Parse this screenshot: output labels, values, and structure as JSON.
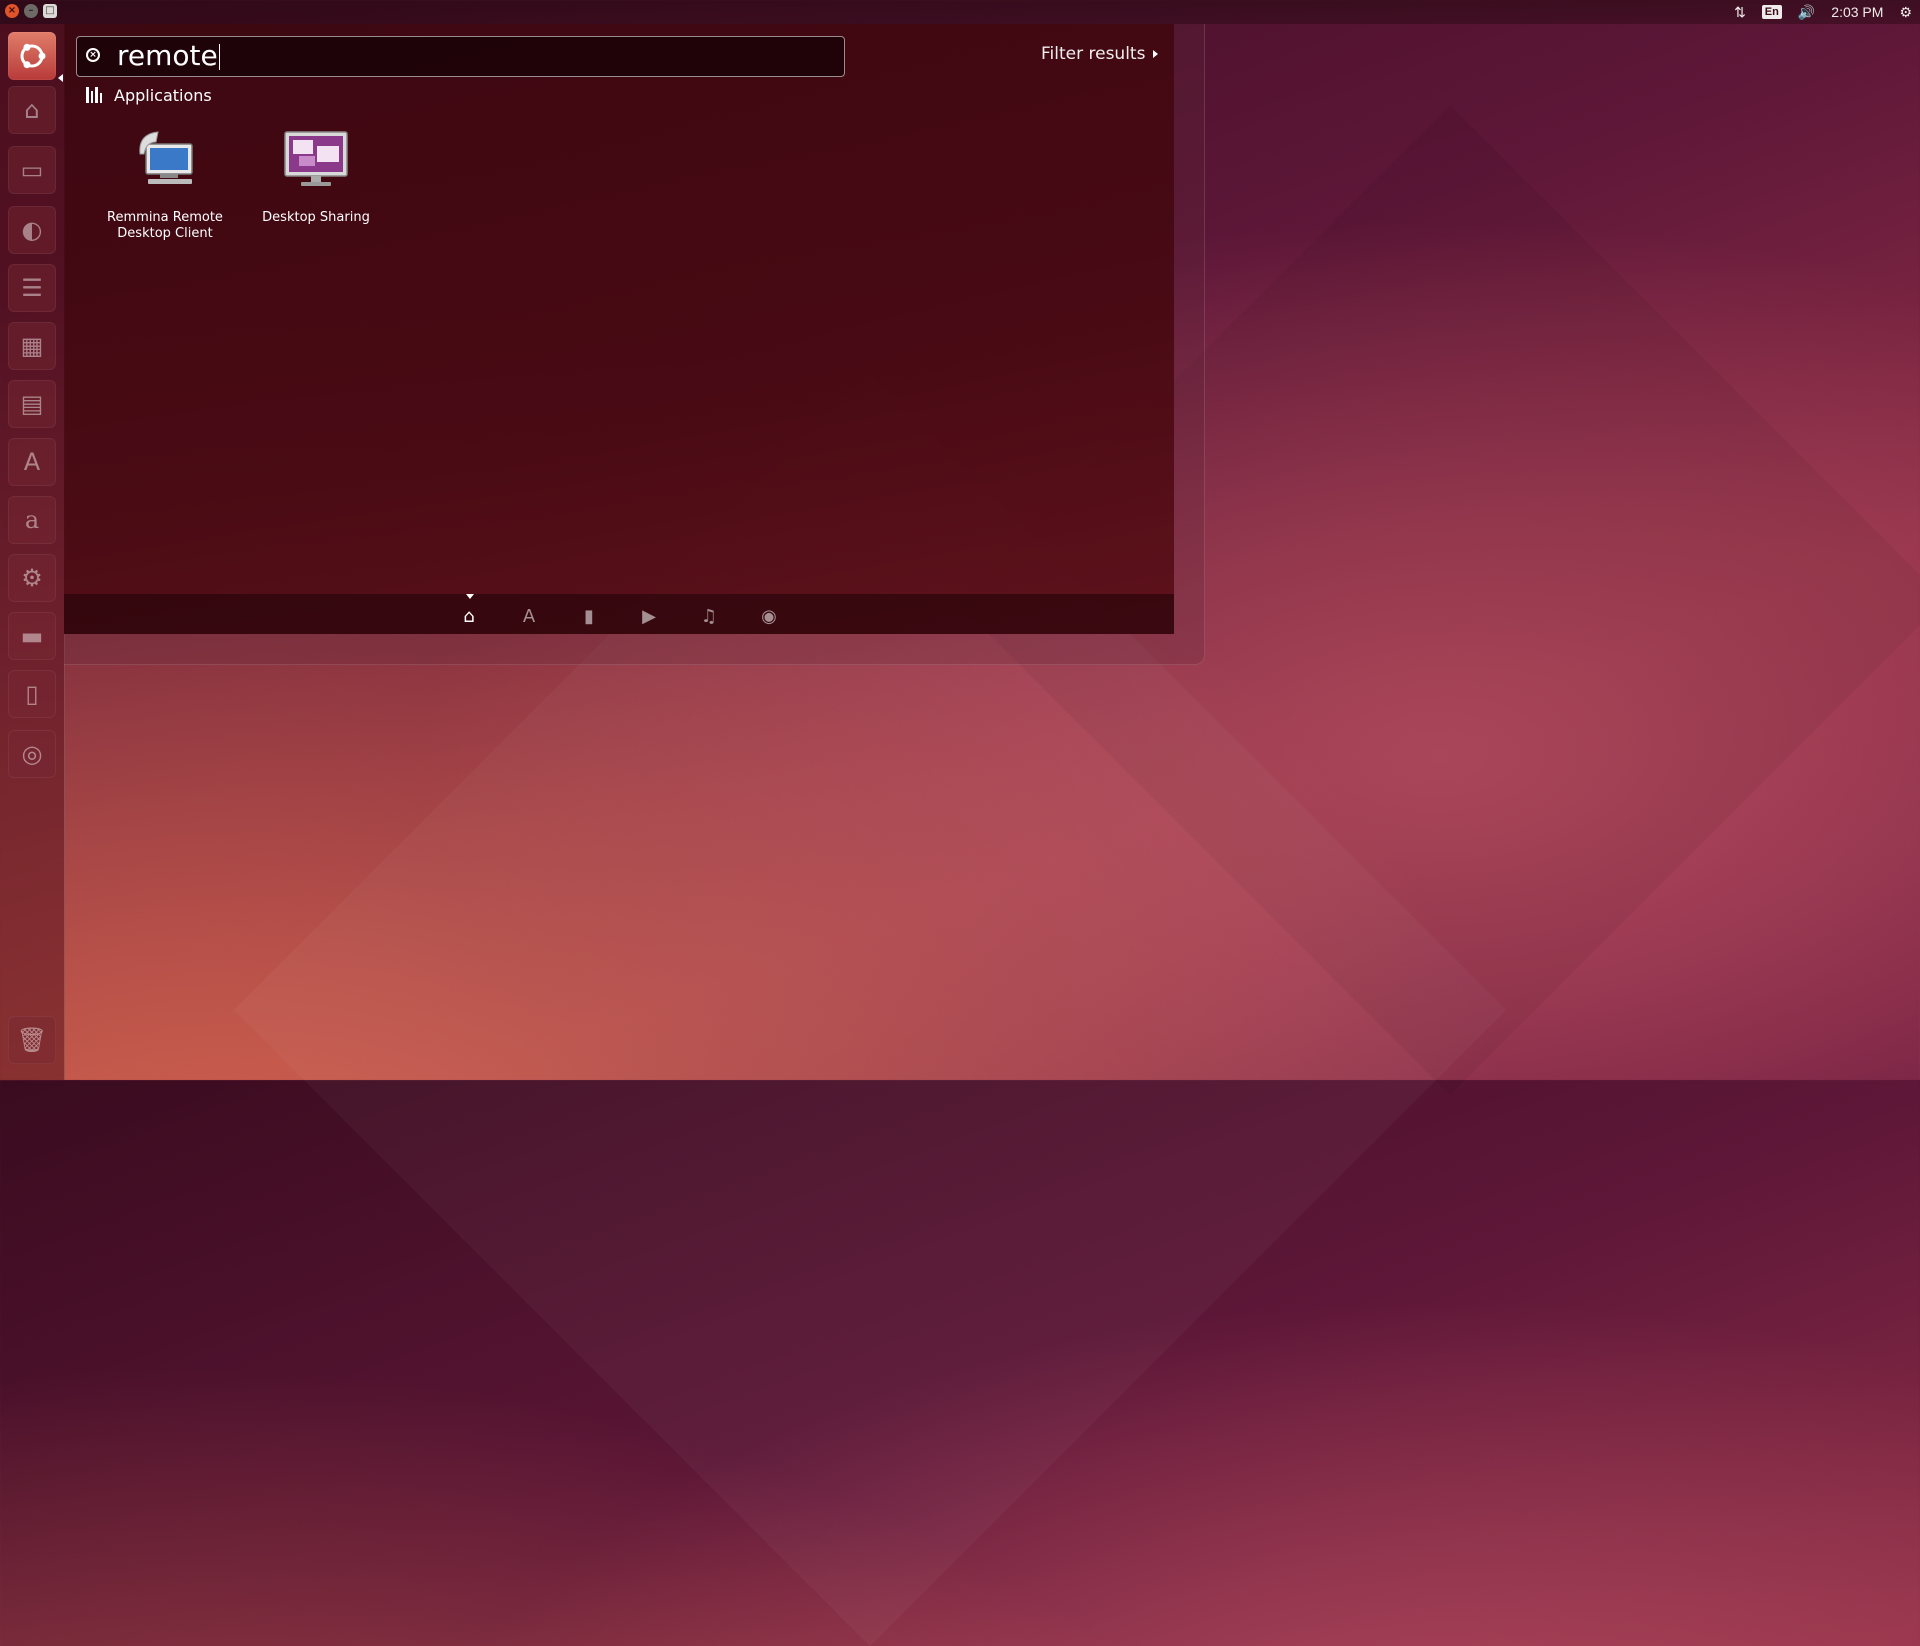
{
  "top_panel": {
    "indicators": {
      "network": "⇅",
      "keyboard": "En",
      "volume": "🔊",
      "clock": "2:03 PM",
      "session": "⚙"
    },
    "window_controls": {
      "close": "×",
      "minimize": "–",
      "maximize": "□"
    }
  },
  "launcher": {
    "items": [
      {
        "name": "dash-home",
        "icon": "ubuntu-logo-icon"
      },
      {
        "name": "files",
        "icon": "home-folder-icon"
      },
      {
        "name": "file-manager",
        "icon": "drawer-icon"
      },
      {
        "name": "firefox",
        "icon": "browser-icon"
      },
      {
        "name": "writer",
        "icon": "document-icon"
      },
      {
        "name": "calc",
        "icon": "spreadsheet-icon"
      },
      {
        "name": "impress",
        "icon": "presentation-icon"
      },
      {
        "name": "software-center",
        "icon": "software-center-icon"
      },
      {
        "name": "amazon",
        "icon": "amazon-icon"
      },
      {
        "name": "system-settings",
        "icon": "settings-icon"
      },
      {
        "name": "disk",
        "icon": "drive-icon"
      },
      {
        "name": "usb",
        "icon": "usb-icon"
      },
      {
        "name": "dvd",
        "icon": "dvd-icon"
      },
      {
        "name": "trash",
        "icon": "trash-icon"
      }
    ]
  },
  "dash": {
    "search": {
      "value": "remote"
    },
    "filter_label": "Filter results",
    "category": "Applications",
    "results": [
      {
        "label_line1": "Remmina Remote",
        "label_line2": "Desktop Client",
        "icon": "remote-desktop-icon"
      },
      {
        "label_line1": "Desktop Sharing",
        "label_line2": "",
        "icon": "desktop-sharing-icon"
      }
    ],
    "lenses": [
      {
        "name": "home",
        "glyph": "⌂",
        "active": true
      },
      {
        "name": "applications",
        "glyph": "A",
        "active": false
      },
      {
        "name": "files",
        "glyph": "▮",
        "active": false
      },
      {
        "name": "video",
        "glyph": "▶",
        "active": false
      },
      {
        "name": "music",
        "glyph": "♫",
        "active": false
      },
      {
        "name": "photos",
        "glyph": "◉",
        "active": false
      }
    ]
  },
  "colors": {
    "accent": "#e95420",
    "dash_bg": "#3c060e"
  }
}
